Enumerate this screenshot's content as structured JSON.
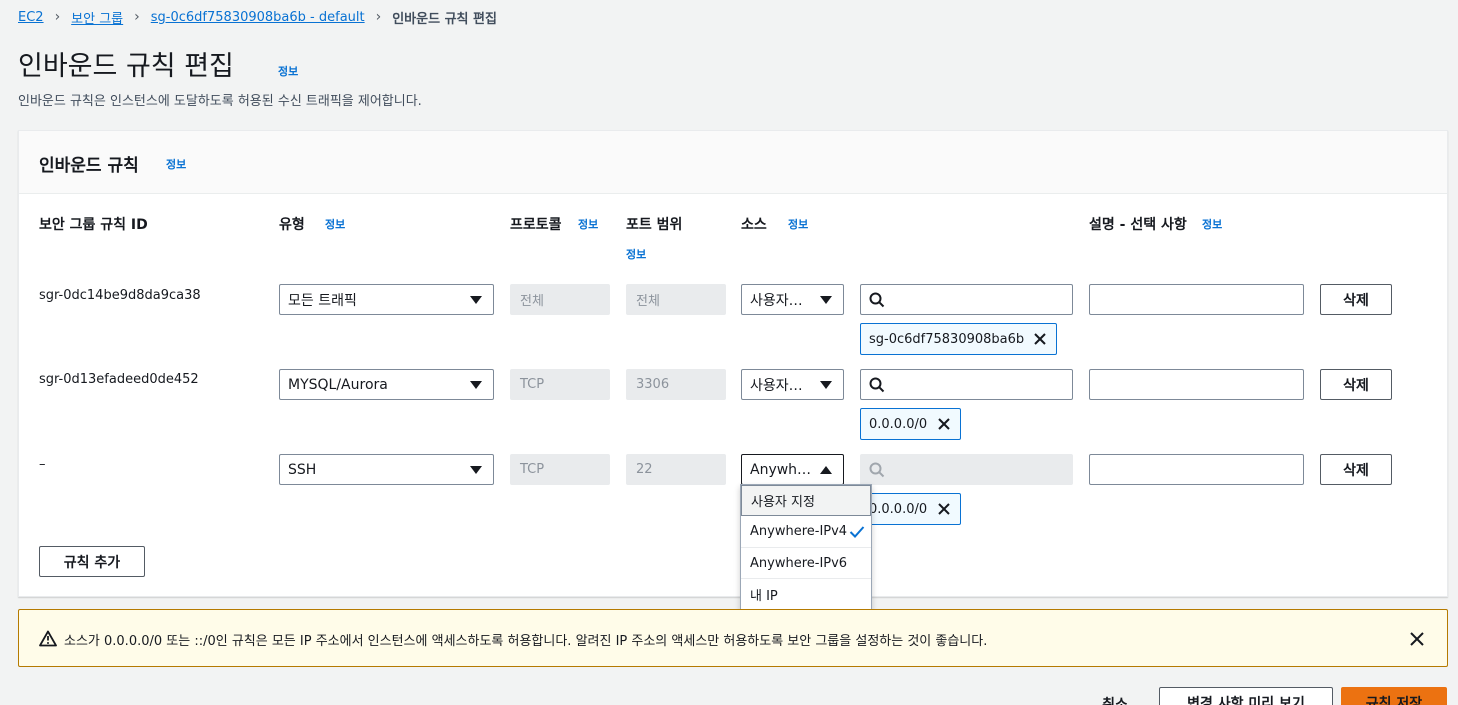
{
  "breadcrumb": {
    "items": [
      "EC2",
      "보안 그룹",
      "sg-0c6df75830908ba6b - default"
    ],
    "current": "인바운드 규칙 편집"
  },
  "page": {
    "title": "인바운드 규칙 편집",
    "title_info": "정보",
    "description": "인바운드 규칙은 인스턴스에 도달하도록 허용된 수신 트래픽을 제어합니다."
  },
  "panel": {
    "title": "인바운드 규칙",
    "title_info": "정보",
    "columns": {
      "rule_id": "보안 그룹 규칙 ID",
      "type": "유형",
      "protocol": "프로토콜",
      "port": "포트 범위",
      "source": "소스",
      "desc": "설명 - 선택 사항",
      "info": "정보"
    },
    "rows": [
      {
        "rule_id": "sgr-0dc14be9d8da9ca38",
        "type": "모든 트래픽",
        "protocol": "전체",
        "port": "전체",
        "source": "사용자…",
        "token": "sg-0c6df75830908ba6b",
        "delete": "삭제"
      },
      {
        "rule_id": "sgr-0d13efadeed0de452",
        "type": "MYSQL/Aurora",
        "protocol": "TCP",
        "port": "3306",
        "source": "사용자…",
        "token": "0.0.0.0/0",
        "delete": "삭제"
      },
      {
        "rule_id": "–",
        "type": "SSH",
        "protocol": "TCP",
        "port": "22",
        "source": "Anywh…",
        "token": "0.0.0.0/0",
        "delete": "삭제"
      }
    ],
    "add_rule": "규칙 추가"
  },
  "source_dropdown": {
    "options": [
      "사용자 지정",
      "Anywhere-IPv4",
      "Anywhere-IPv6",
      "내 IP"
    ],
    "selected": "Anywhere-IPv4"
  },
  "alert": {
    "text": "소스가 0.0.0.0/0 또는 ::/0인 규칙은 모든 IP 주소에서 인스턴스에 액세스하도록 허용합니다. 알려진 IP 주소의 액세스만 허용하도록 보안 그룹을 설정하는 것이 좋습니다."
  },
  "footer": {
    "cancel": "취소",
    "preview": "변경 사항 미리 보기",
    "save": "규칙 저장"
  },
  "colors": {
    "link": "#0972d3",
    "primary": "#ec7211",
    "warning_border": "#b57a00",
    "warning_bg": "#fffce9"
  }
}
